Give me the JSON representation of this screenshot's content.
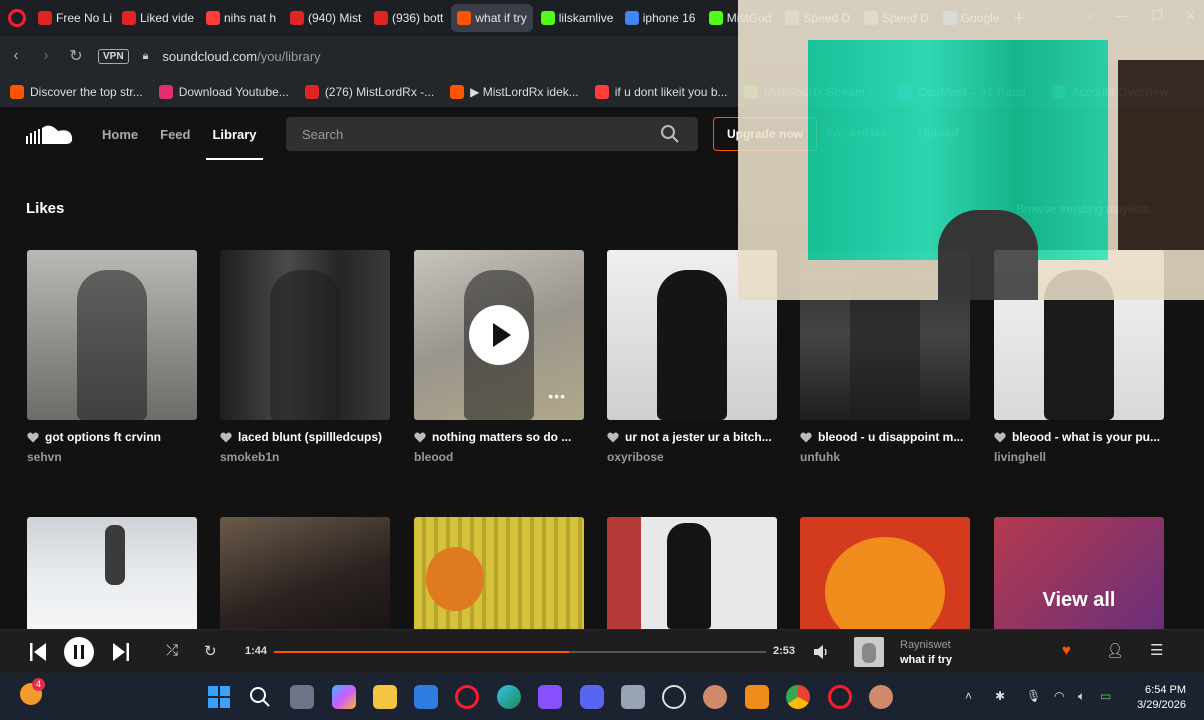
{
  "browser": {
    "tabs": [
      {
        "label": "Free No Li",
        "color": "#e02424"
      },
      {
        "label": "Liked vide",
        "color": "#e02424"
      },
      {
        "label": "nihs nat h",
        "color": "#ff3b3b"
      },
      {
        "label": "(940) Mist",
        "color": "#e02424"
      },
      {
        "label": "(936) bott",
        "color": "#e02424"
      },
      {
        "label": "what if try",
        "color": "#ff5500",
        "active": true
      },
      {
        "label": "lilskamlive",
        "color": "#53fc18"
      },
      {
        "label": "iphone 16",
        "color": "#4285f4"
      },
      {
        "label": "MistGod",
        "color": "#53fc18"
      },
      {
        "label": "Speed D",
        "color": "#888888"
      },
      {
        "label": "Speed D",
        "color": "#888888"
      },
      {
        "label": "Google",
        "color": "#4285f4"
      }
    ],
    "vpn_label": "VPN",
    "url_host": "soundcloud.com",
    "url_path": "/you/library",
    "bookmarks": [
      {
        "label": "Discover the top str...",
        "color": "#ff5500"
      },
      {
        "label": "Download Youtube...",
        "color": "#e0306e"
      },
      {
        "label": "(276) MistLordRx -...",
        "color": "#e02424"
      },
      {
        "label": "▶ MistLordRx idek...",
        "color": "#ff5500"
      },
      {
        "label": "if u dont likeit you b...",
        "color": "#ff3b3b"
      },
      {
        "label": "MistGodRx Stream -...",
        "color": "#53fc18"
      },
      {
        "label": "CooMeet – #1 Rand...",
        "color": "#7a5cff"
      },
      {
        "label": "Account Overview",
        "color": "#1ed760"
      }
    ]
  },
  "soundcloud": {
    "nav": {
      "home": "Home",
      "feed": "Feed",
      "library": "Library"
    },
    "search_placeholder": "Search",
    "upgrade_label": "Upgrade now",
    "for_artists": "For Artists",
    "upload": "Upload",
    "section_title": "Likes",
    "browse_link": "Browse trending playlists",
    "likes_row1": [
      {
        "title": "got options ft crvinn",
        "artist": "sehvn"
      },
      {
        "title": "laced blunt (spillledcups)",
        "artist": "smokeb1n"
      },
      {
        "title": "nothing matters so do ...",
        "artist": "bleood"
      },
      {
        "title": "ur not a jester ur a bitch...",
        "artist": "oxyribose"
      },
      {
        "title": "bleood - u disappoint m...",
        "artist": "unfuhk"
      },
      {
        "title": "bleood - what is your pu...",
        "artist": "livinghell"
      }
    ],
    "view_all": "View all"
  },
  "player": {
    "elapsed": "1:44",
    "duration": "2:53",
    "progress": 0.6,
    "artist": "Rayniswet",
    "title": "what if try"
  },
  "taskbar": {
    "time": "6:54 PM",
    "date": "3/29/2026",
    "badge": "4"
  },
  "colors": {
    "accent": "#ff5500",
    "background": "#121212"
  }
}
